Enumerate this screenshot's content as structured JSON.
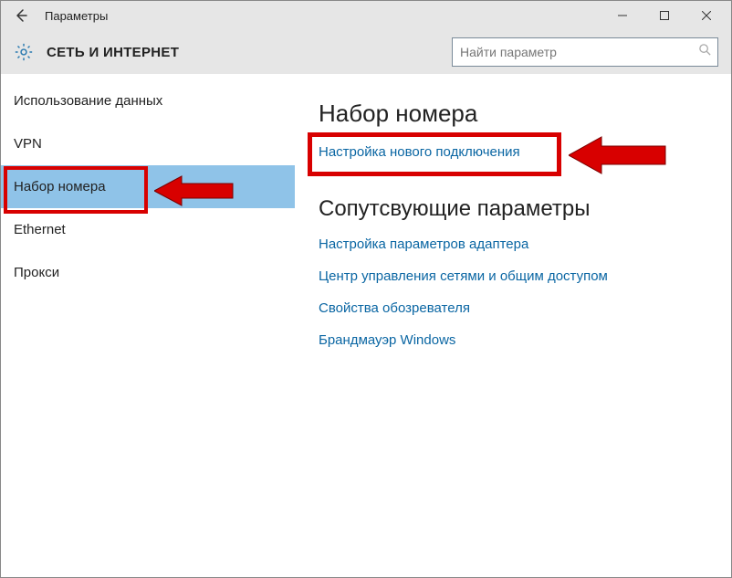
{
  "window": {
    "title": "Параметры"
  },
  "header": {
    "page_title": "СЕТЬ И ИНТЕРНЕТ"
  },
  "search": {
    "placeholder": "Найти параметр"
  },
  "sidebar": {
    "items": [
      {
        "label": "Использование данных",
        "selected": false
      },
      {
        "label": "VPN",
        "selected": false
      },
      {
        "label": "Набор номера",
        "selected": true
      },
      {
        "label": "Ethernet",
        "selected": false
      },
      {
        "label": "Прокси",
        "selected": false
      }
    ]
  },
  "main": {
    "heading": "Набор номера",
    "primary_link": "Настройка нового подключения",
    "related_heading": "Сопутсвующие параметры",
    "related_links": [
      "Настройка параметров адаптера",
      "Центр управления сетями и общим доступом",
      "Свойства обозревателя",
      "Брандмауэр Windows"
    ]
  },
  "annotations": {
    "highlight_color": "#d80000"
  }
}
